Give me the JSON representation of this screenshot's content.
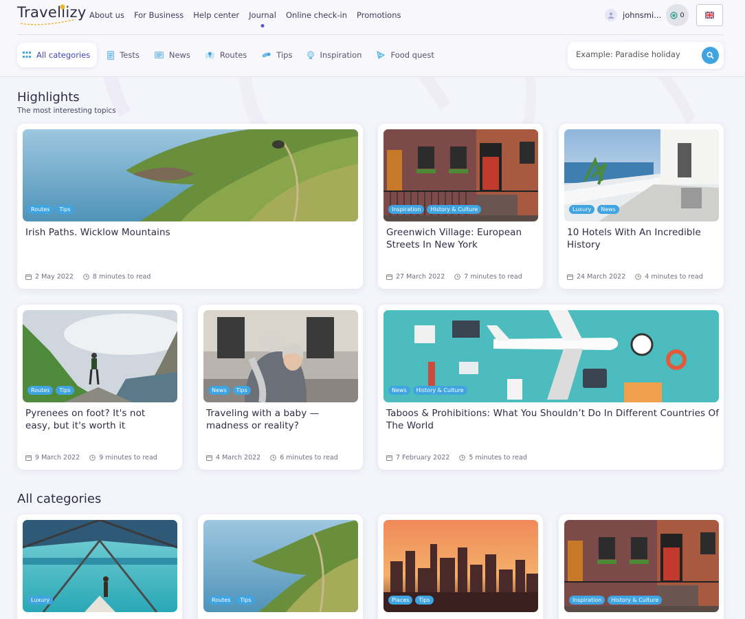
{
  "brand": {
    "name": "Travellizy"
  },
  "nav": [
    {
      "label": "About us"
    },
    {
      "label": "For Business"
    },
    {
      "label": "Help center"
    },
    {
      "label": "Journal",
      "active": true
    },
    {
      "label": "Online check-in"
    },
    {
      "label": "Promotions"
    }
  ],
  "user": {
    "name": "johnsmi...",
    "points": "0"
  },
  "categories": [
    {
      "label": "All categories",
      "icon": "grid-icon",
      "selected": true
    },
    {
      "label": "Tests",
      "icon": "document-icon"
    },
    {
      "label": "News",
      "icon": "newspaper-icon"
    },
    {
      "label": "Routes",
      "icon": "map-pin-icon"
    },
    {
      "label": "Tips",
      "icon": "pills-icon"
    },
    {
      "label": "Inspiration",
      "icon": "lightbulb-icon"
    },
    {
      "label": "Food quest",
      "icon": "pizza-icon"
    }
  ],
  "search": {
    "placeholder": "Example: Paradise holiday"
  },
  "highlights": {
    "title": "Highlights",
    "subtitle": "The most interesting topics"
  },
  "articles": [
    {
      "title": "Irish Paths. Wicklow Mountains",
      "tags": [
        "Routes",
        "Tips"
      ],
      "date": "2 May 2022",
      "read": "8 minutes to read",
      "image": "coast-cliffs"
    },
    {
      "title": "Greenwich Village: European Streets In New York",
      "tags": [
        "Inspiration",
        "History & Culture"
      ],
      "date": "27 March 2022",
      "read": "7 minutes to read",
      "image": "brick-townhouse"
    },
    {
      "title": "10 Hotels With An Incredible History",
      "tags": [
        "Luxury",
        "News"
      ],
      "date": "24 March 2022",
      "read": "4 minutes to read",
      "image": "hotel-terrace"
    },
    {
      "title": "Pyrenees on foot? It's not easy, but it's worth it",
      "tags": [
        "Routes",
        "Tips"
      ],
      "date": "9 March 2022",
      "read": "9 minutes to read",
      "image": "mountain-hiker"
    },
    {
      "title": "Traveling with a baby — madness or reality?",
      "tags": [
        "News",
        "Tips"
      ],
      "date": "4 March 2022",
      "read": "6 minutes to read",
      "image": "father-baby"
    },
    {
      "title": "Taboos & Prohibitions: What You Shouldn’t Do In Different Countries Of The World",
      "tags": [
        "News",
        "History & Culture"
      ],
      "date": "7 February 2022",
      "read": "5 minutes to read",
      "image": "travel-flatlay"
    }
  ],
  "all_categories": {
    "title": "All categories",
    "cards": [
      {
        "tags": [
          "Luxury"
        ],
        "image": "tropical-pier"
      },
      {
        "tags": [
          "Routes",
          "Tips"
        ],
        "image": "coast-cliffs"
      },
      {
        "tags": [
          "Places",
          "Tips"
        ],
        "image": "city-sunset"
      },
      {
        "tags": [
          "Inspiration",
          "History & Culture"
        ],
        "image": "brick-townhouse"
      }
    ]
  },
  "colors": {
    "accent": "#3fa4e0",
    "brand": "#4643b8",
    "text": "#2c2c44"
  }
}
